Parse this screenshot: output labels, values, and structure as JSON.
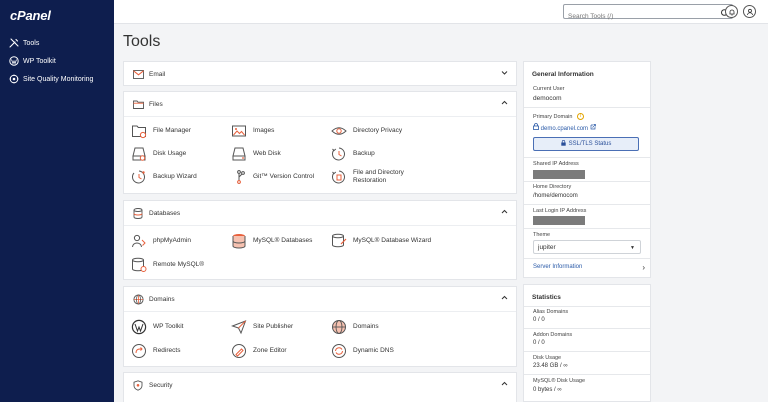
{
  "brand": {
    "logo_text": "cPanel"
  },
  "sidebar": {
    "items": [
      {
        "label": "Tools",
        "icon": "tools-icon"
      },
      {
        "label": "WP Toolkit",
        "icon": "wordpress-icon"
      },
      {
        "label": "Site Quality Monitoring",
        "icon": "monitoring-icon"
      }
    ]
  },
  "topbar": {
    "search_placeholder": "Search Tools (/)"
  },
  "page": {
    "title": "Tools"
  },
  "sections": {
    "email": {
      "title": "Email"
    },
    "files": {
      "title": "Files",
      "tools": [
        "File Manager",
        "Images",
        "Directory Privacy",
        "Disk Usage",
        "Web Disk",
        "Backup",
        "Backup Wizard",
        "Git™ Version Control",
        "File and Directory",
        "Restoration"
      ]
    },
    "databases": {
      "title": "Databases",
      "tools": [
        "phpMyAdmin",
        "MySQL® Databases",
        "MySQL® Database Wizard",
        "Remote MySQL®"
      ]
    },
    "domains": {
      "title": "Domains",
      "tools": [
        "WP Toolkit",
        "Site Publisher",
        "Domains",
        "Redirects",
        "Zone Editor",
        "Dynamic DNS"
      ]
    },
    "security": {
      "title": "Security"
    }
  },
  "general_info": {
    "title": "General Information",
    "current_user_label": "Current User",
    "current_user": "democom",
    "primary_domain_label": "Primary Domain",
    "primary_domain": "demo.cpanel.com",
    "ssl_button": "SSL/TLS Status",
    "shared_ip_label": "Shared IP Address",
    "home_dir_label": "Home Directory",
    "home_dir": "/home/democom",
    "last_login_label": "Last Login IP Address",
    "theme_label": "Theme",
    "theme_value": "jupiter",
    "server_info_link": "Server Information"
  },
  "statistics": {
    "title": "Statistics",
    "items": [
      {
        "label": "Alias Domains",
        "value": "0 / 0"
      },
      {
        "label": "Addon Domains",
        "value": "0 / 0"
      },
      {
        "label": "Disk Usage",
        "value": "23.48 GB / ∞"
      },
      {
        "label": "MySQL® Disk Usage",
        "value": "0 bytes / ∞"
      }
    ]
  },
  "colors": {
    "sidebar_bg": "#0e1e4e",
    "accent_orange": "#e8603c",
    "link_blue": "#2a5aa8"
  }
}
